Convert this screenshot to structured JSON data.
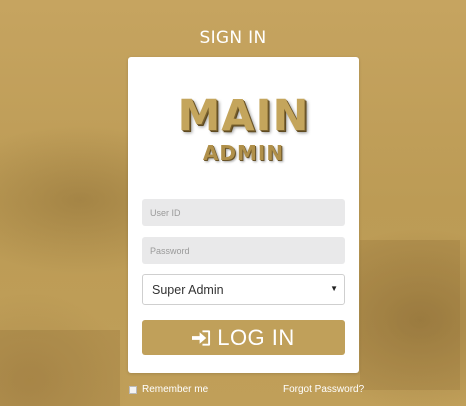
{
  "header": {
    "title": "SIGN IN"
  },
  "logo": {
    "main": "MAIN",
    "sub": "ADMIN"
  },
  "form": {
    "user_id_placeholder": "User ID",
    "password_placeholder": "Password",
    "role_selected": "Super Admin",
    "login_label": "LOG IN",
    "remember_label": "Remember me",
    "forgot_label": "Forgot Password?"
  },
  "colors": {
    "accent": "#c0a05a",
    "card": "#ffffff",
    "input_bg": "#e9e9ea"
  },
  "icons": {
    "login": "sign-in-icon",
    "dropdown": "caret-down-icon"
  }
}
